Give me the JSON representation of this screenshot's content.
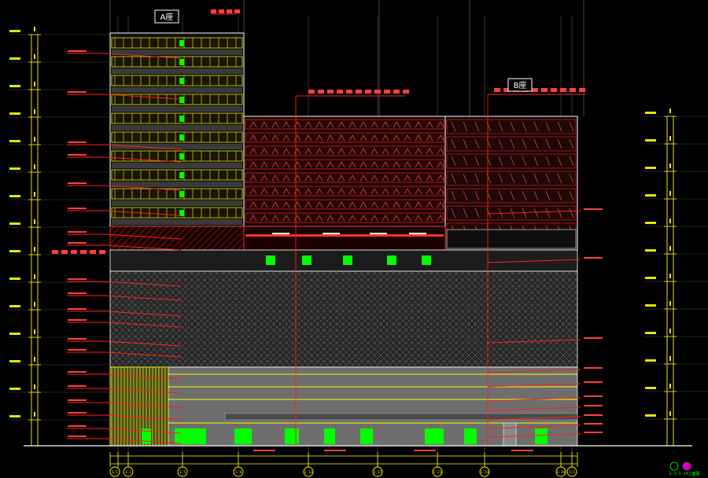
{
  "drawing": {
    "tower_a_label": "A座",
    "tower_b_label": "B座",
    "bottom_note": "1-1~1-24立面图"
  },
  "axis_labels": [
    "1/1",
    "1-1",
    "1-5",
    "1-8",
    "1-13",
    "1-17",
    "1-21",
    "1-23",
    "1-24"
  ],
  "colors": {
    "background": "#000000",
    "outline": "#ffffff",
    "leader": "#ff2020",
    "frame": "#ffff00",
    "glass": "#8c8c8c",
    "window": "#00ff00",
    "grid": "#c8c8c8"
  }
}
